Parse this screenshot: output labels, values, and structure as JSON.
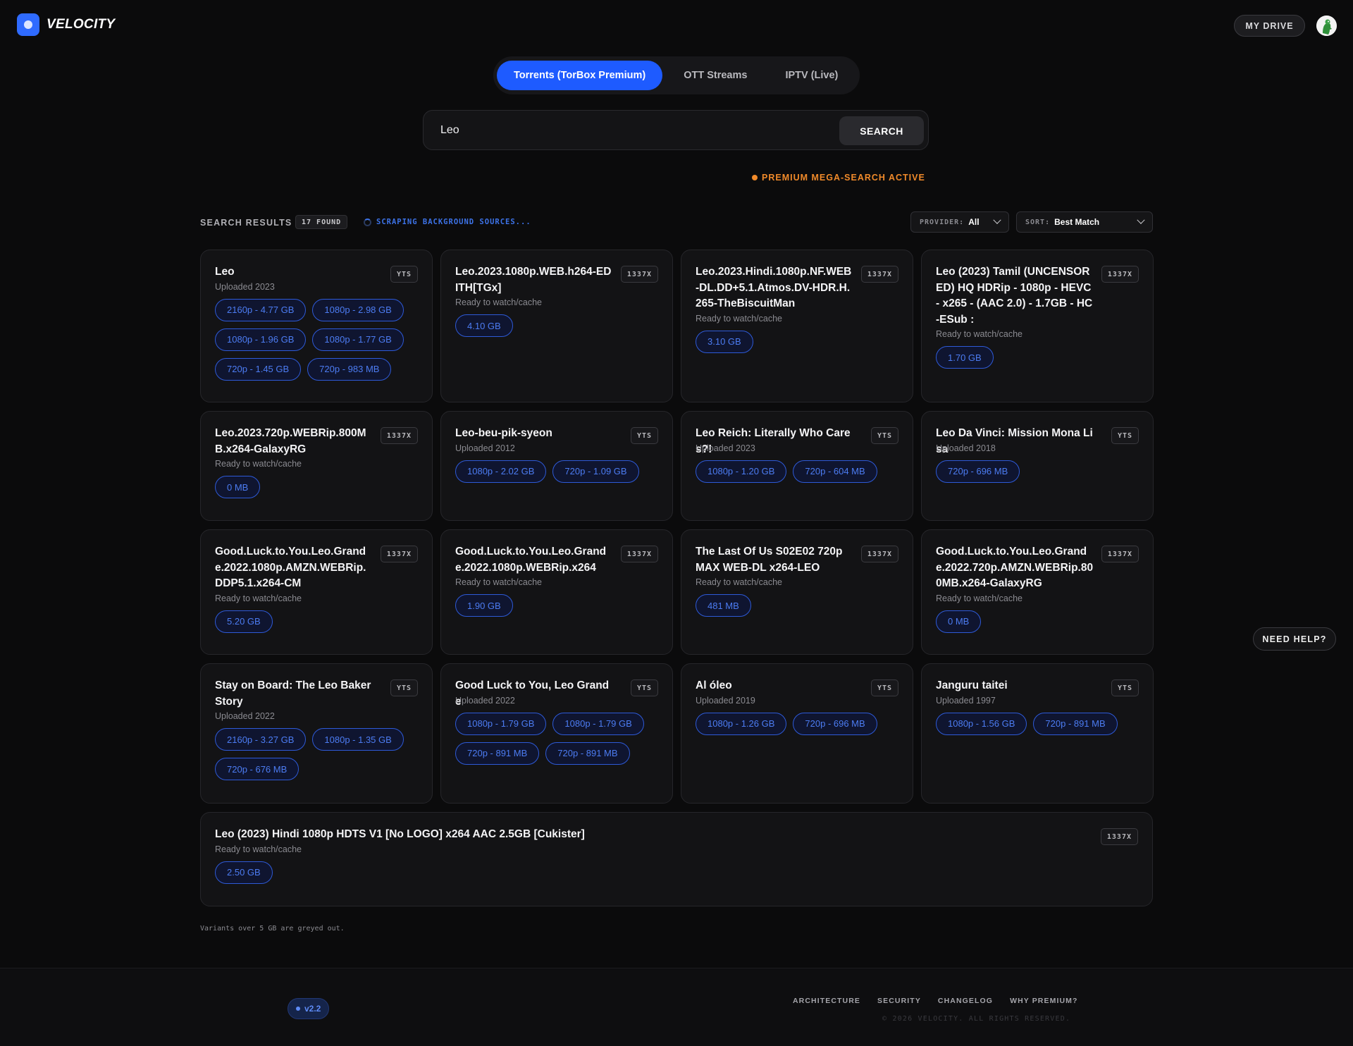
{
  "app": {
    "name": "VELOCITY",
    "logo_icon": "velocity-logo-icon"
  },
  "header": {
    "my_drive_label": "MY DRIVE",
    "avatar_icon": "user-avatar-icon"
  },
  "modes": [
    {
      "label": "Torrents (TorBox Premium)",
      "active": true
    },
    {
      "label": "OTT Streams",
      "active": false
    },
    {
      "label": "IPTV (Live)",
      "active": false
    }
  ],
  "search": {
    "value": "Leo",
    "button_label": "SEARCH"
  },
  "premium_status": "PREMIUM MEGA-SEARCH ACTIVE",
  "results": {
    "title": "SEARCH RESULTS",
    "count": "17 FOUND",
    "scraping": "SCRAPING BACKGROUND SOURCES...",
    "provider_label": "PROVIDER:",
    "provider_value": "All",
    "sort_label": "SORT:",
    "sort_value": "Best Match"
  },
  "cards": [
    {
      "title": "Leo",
      "sub": "Uploaded 2023",
      "source": "YTS",
      "pills": [
        "2160p - 4.77 GB",
        "1080p - 2.98 GB",
        "1080p - 1.96 GB",
        "1080p - 1.77 GB",
        "720p - 1.45 GB",
        "720p - 983 MB"
      ]
    },
    {
      "title": "Leo.2023.1080p.WEB.h264-EDITH[TGx]",
      "sub": "Ready to watch/cache",
      "source": "1337X",
      "pills": [
        "4.10 GB"
      ]
    },
    {
      "title": "Leo.2023.Hindi.1080p.NF.WEB-DL.DD+5.1.Atmos.DV-HDR.H.265-TheBiscuitMan",
      "sub": "Ready to watch/cache",
      "source": "1337X",
      "pills": [
        "3.10 GB"
      ]
    },
    {
      "title": "Leo (2023) Tamil (UNCENSORED) HQ HDRip - 1080p - HEVC - x265 - (AAC 2.0) - 1.7GB - HC-ESub :",
      "sub": "Ready to watch/cache",
      "source": "1337X",
      "pills": [
        "1.70 GB"
      ]
    },
    {
      "title": "Leo.2023.720p.WEBRip.800MB.x264-GalaxyRG",
      "sub": "Ready to watch/cache",
      "source": "1337X",
      "pills": [
        "0 MB"
      ]
    },
    {
      "title": "Leo-beu-pik-syeon",
      "sub": "Uploaded 2012",
      "source": "YTS",
      "pills": [
        "1080p - 2.02 GB",
        "720p - 1.09 GB"
      ]
    },
    {
      "title": "Leo Reich: Literally Who Cares?!",
      "sub": "Uploaded 2023",
      "source": "YTS",
      "pills": [
        "1080p - 1.20 GB",
        "720p - 604 MB"
      ]
    },
    {
      "title": "Leo Da Vinci: Mission Mona Lisa",
      "sub": "Uploaded 2018",
      "source": "YTS",
      "pills": [
        "720p - 696 MB"
      ]
    },
    {
      "title": "Good.Luck.to.You.Leo.Grande.2022.1080p.AMZN.WEBRip.DDP5.1.x264-CM",
      "sub": "Ready to watch/cache",
      "source": "1337X",
      "pills": [
        "5.20 GB"
      ]
    },
    {
      "title": "Good.Luck.to.You.Leo.Grande.2022.1080p.WEBRip.x264",
      "sub": "Ready to watch/cache",
      "source": "1337X",
      "pills": [
        "1.90 GB"
      ]
    },
    {
      "title": "The Last Of Us S02E02 720p MAX WEB-DL x264-LEO",
      "sub": "Ready to watch/cache",
      "source": "1337X",
      "pills": [
        "481 MB"
      ]
    },
    {
      "title": "Good.Luck.to.You.Leo.Grande.2022.720p.AMZN.WEBRip.800MB.x264-GalaxyRG",
      "sub": "Ready to watch/cache",
      "source": "1337X",
      "pills": [
        "0 MB"
      ]
    },
    {
      "title": "Stay on Board: The Leo Baker Story",
      "sub": "Uploaded 2022",
      "source": "YTS",
      "pills": [
        "2160p - 3.27 GB",
        "1080p - 1.35 GB",
        "720p - 676 MB"
      ]
    },
    {
      "title": "Good Luck to You, Leo Grande",
      "sub": "Uploaded 2022",
      "source": "YTS",
      "pills": [
        "1080p - 1.79 GB",
        "1080p - 1.79 GB",
        "720p - 891 MB",
        "720p - 891 MB"
      ]
    },
    {
      "title": "Al óleo",
      "sub": "Uploaded 2019",
      "source": "YTS",
      "pills": [
        "1080p - 1.26 GB",
        "720p - 696 MB"
      ]
    },
    {
      "title": "Janguru taitei",
      "sub": "Uploaded 1997",
      "source": "YTS",
      "pills": [
        "1080p - 1.56 GB",
        "720p - 891 MB"
      ]
    },
    {
      "title": "Leo (2023) Hindi 1080p HDTS V1 [No LOGO] x264 AAC 2.5GB [Cukister]",
      "sub": "Ready to watch/cache",
      "source": "1337X",
      "pills": [
        "2.50 GB"
      ]
    }
  ],
  "note": "Variants over 5 GB are greyed out.",
  "help_label": "NEED HELP?",
  "footer": {
    "version": "v2.2",
    "links": [
      "ARCHITECTURE",
      "SECURITY",
      "CHANGELOG",
      "WHY PREMIUM?"
    ],
    "copyright": "© 2026 VELOCITY. ALL RIGHTS RESERVED."
  },
  "colors": {
    "accent": "#1e5bff",
    "premium": "#f08a2a",
    "pill_text": "#4c7cf2",
    "background": "#0b0b0c"
  }
}
